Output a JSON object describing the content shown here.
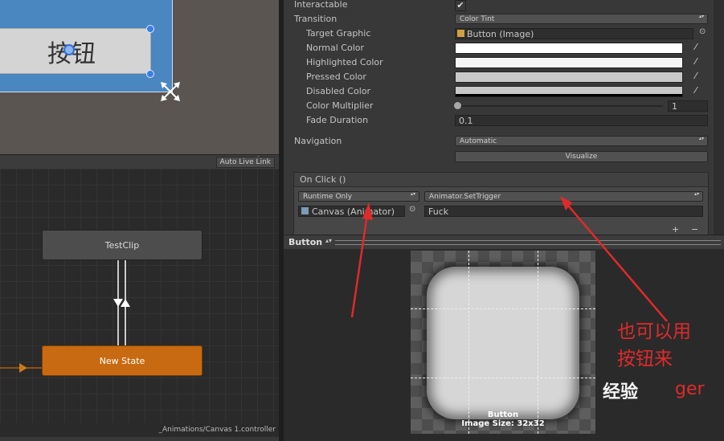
{
  "scene": {
    "button_text": "按钮"
  },
  "animator": {
    "auto_live_link": "Auto Live Link",
    "state_top": "TestClip",
    "state_bottom": "New State",
    "footer_path": "_Animations/Canvas 1.controller"
  },
  "inspector": {
    "interactable_label": "Interactable",
    "interactable_checked": true,
    "transition_label": "Transition",
    "transition_value": "Color Tint",
    "target_graphic_label": "Target Graphic",
    "target_graphic_value": "Button (Image)",
    "normal_color_label": "Normal Color",
    "highlighted_color_label": "Highlighted Color",
    "pressed_color_label": "Pressed Color",
    "disabled_color_label": "Disabled Color",
    "color_multiplier_label": "Color Multiplier",
    "color_multiplier_value": "1",
    "fade_duration_label": "Fade Duration",
    "fade_duration_value": "0.1",
    "navigation_label": "Navigation",
    "navigation_value": "Automatic",
    "visualize_label": "Visualize",
    "onclick_header": "On Click ()",
    "runtime_value": "Runtime Only",
    "function_value": "Animator.SetTrigger",
    "object_value": "Canvas (Animator)",
    "argument_value": "Fuck",
    "add_label": "+",
    "remove_label": "−",
    "colors": {
      "normal": "#ffffff",
      "highlighted": "#f5f5f5",
      "pressed": "#c8c8c8",
      "disabled": "#c8c8c8"
    }
  },
  "preview": {
    "title": "Button",
    "caption_name": "Button",
    "caption_size": "Image Size: 32x32"
  },
  "annotation": {
    "line1": "也可以用",
    "line2": "按钮来",
    "watermark": "经验",
    "watermark_suffix": "ger"
  }
}
